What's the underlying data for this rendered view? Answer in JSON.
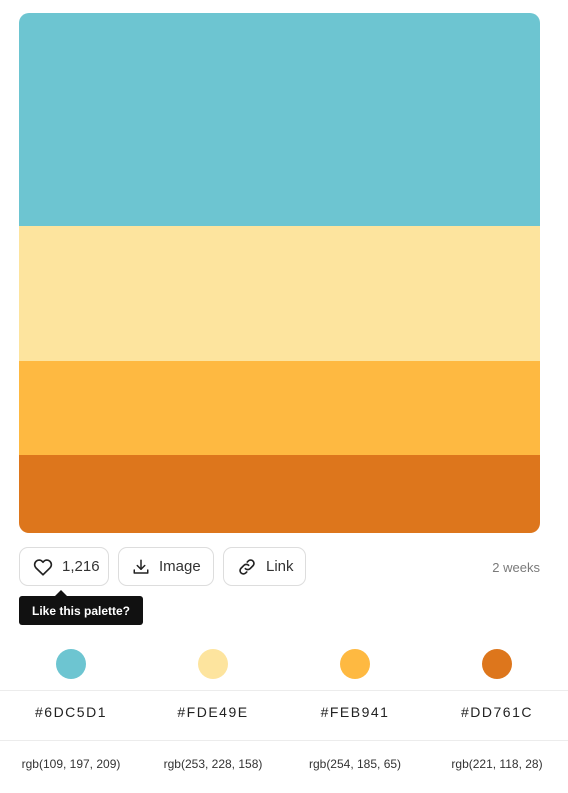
{
  "palette": {
    "colors": [
      "#6DC5D1",
      "#FDE49E",
      "#FEB941",
      "#DD761C"
    ]
  },
  "actions": {
    "like_count": "1,216",
    "image_label": "Image",
    "link_label": "Link"
  },
  "age": "2 weeks",
  "tooltip": "Like this palette?",
  "swatches": {
    "hex": [
      "#6DC5D1",
      "#FDE49E",
      "#FEB941",
      "#DD761C"
    ],
    "rgb": [
      "rgb(109, 197, 209)",
      "rgb(253, 228, 158)",
      "rgb(254, 185, 65)",
      "rgb(221, 118, 28)"
    ]
  },
  "icons": {
    "like": "heart-icon",
    "image": "download-icon",
    "link": "link-icon"
  }
}
